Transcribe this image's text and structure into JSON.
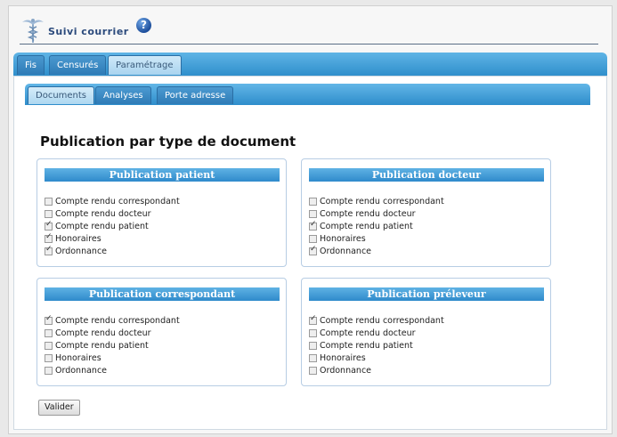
{
  "header": {
    "app_title": "Suivi courrier",
    "help_icon": "?"
  },
  "main_tabs": [
    {
      "label": "Fis",
      "active": false
    },
    {
      "label": "Censurés",
      "active": false
    },
    {
      "label": "Paramétrage",
      "active": true
    }
  ],
  "sub_tabs": [
    {
      "label": "Documents",
      "active": true
    },
    {
      "label": "Analyses",
      "active": false
    },
    {
      "label": "Porte adresse",
      "active": false
    }
  ],
  "page_title": "Publication par type de document",
  "groups": [
    {
      "title": "Publication patient",
      "options": [
        {
          "label": "Compte rendu correspondant",
          "checked": false
        },
        {
          "label": "Compte rendu docteur",
          "checked": false
        },
        {
          "label": "Compte rendu patient",
          "checked": true
        },
        {
          "label": "Honoraires",
          "checked": true
        },
        {
          "label": "Ordonnance",
          "checked": true
        }
      ]
    },
    {
      "title": "Publication docteur",
      "options": [
        {
          "label": "Compte rendu correspondant",
          "checked": false
        },
        {
          "label": "Compte rendu docteur",
          "checked": false
        },
        {
          "label": "Compte rendu patient",
          "checked": true
        },
        {
          "label": "Honoraires",
          "checked": false
        },
        {
          "label": "Ordonnance",
          "checked": true
        }
      ]
    },
    {
      "title": "Publication correspondant",
      "options": [
        {
          "label": "Compte rendu correspondant",
          "checked": true
        },
        {
          "label": "Compte rendu docteur",
          "checked": false
        },
        {
          "label": "Compte rendu patient",
          "checked": false
        },
        {
          "label": "Honoraires",
          "checked": false
        },
        {
          "label": "Ordonnance",
          "checked": false
        }
      ]
    },
    {
      "title": "Publication préleveur",
      "options": [
        {
          "label": "Compte rendu correspondant",
          "checked": true
        },
        {
          "label": "Compte rendu docteur",
          "checked": false
        },
        {
          "label": "Compte rendu patient",
          "checked": false
        },
        {
          "label": "Honoraires",
          "checked": false
        },
        {
          "label": "Ordonnance",
          "checked": false
        }
      ]
    }
  ],
  "submit_label": "Valider",
  "colors": {
    "tab_blue": "#2f8fcc",
    "title_navy": "#2b4a7c"
  }
}
